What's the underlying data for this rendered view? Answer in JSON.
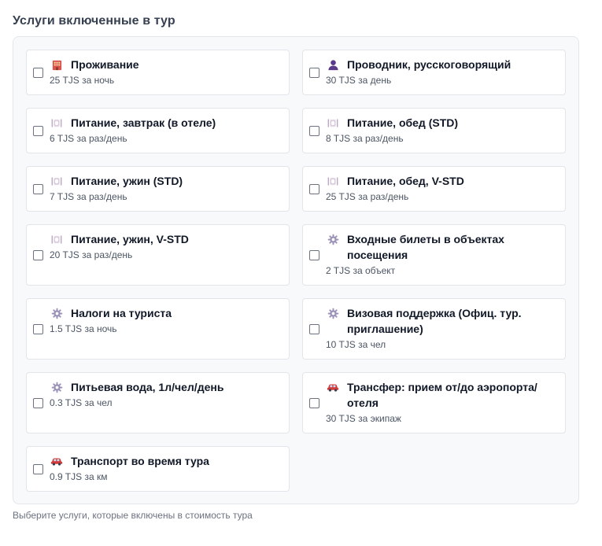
{
  "section": {
    "title": "Услуги включенные в тур",
    "helper": "Выберите услуги, которые включены в стоимость тура"
  },
  "services": [
    {
      "title_lines": [
        "Проживание"
      ],
      "price": "25 TJS за ночь",
      "icon": "hotel-icon",
      "checked": false
    },
    {
      "title_lines": [
        "Проводник, русскоговорящий"
      ],
      "price": "30 TJS за день",
      "icon": "guide-person-icon",
      "checked": false
    },
    {
      "title_lines": [
        "Питание, завтрак (в отеле)"
      ],
      "price": "6 TJS за раз/день",
      "icon": "plate-cutlery-icon",
      "checked": false
    },
    {
      "title_lines": [
        "Питание, обед (STD)"
      ],
      "price": "8 TJS за раз/день",
      "icon": "plate-cutlery-icon",
      "checked": false
    },
    {
      "title_lines": [
        "Питание, ужин (STD)"
      ],
      "price": "7 TJS за раз/день",
      "icon": "plate-cutlery-icon",
      "checked": false
    },
    {
      "title_lines": [
        "Питание, обед, V-STD"
      ],
      "price": "25 TJS за раз/день",
      "icon": "plate-cutlery-icon",
      "checked": false
    },
    {
      "title_lines": [
        "Питание, ужин, V-STD"
      ],
      "price": "20 TJS за раз/день",
      "icon": "plate-cutlery-icon",
      "checked": false
    },
    {
      "title_lines": [
        "Входные билеты в объектах",
        "посещения"
      ],
      "price": "2 TJS за объект",
      "icon": "gear-icon",
      "checked": false
    },
    {
      "title_lines": [
        "Налоги на туриста"
      ],
      "price": "1.5 TJS за ночь",
      "icon": "gear-icon",
      "checked": false
    },
    {
      "title_lines": [
        "Визовая поддержка (Офиц. тур.",
        "приглашение)"
      ],
      "price": "10 TJS за чел",
      "icon": "gear-icon",
      "checked": false
    },
    {
      "title_lines": [
        "Питьевая вода, 1л/чел/день"
      ],
      "price": "0.3 TJS за чел",
      "icon": "gear-icon",
      "checked": false
    },
    {
      "title_lines": [
        "Трансфер: прием от/до аэропорта/",
        "отеля"
      ],
      "price": "30 TJS за экипаж",
      "icon": "car-icon",
      "checked": false
    },
    {
      "title_lines": [
        "Транспорт во время тура"
      ],
      "price": "0.9 TJS за км",
      "icon": "car-icon",
      "checked": false
    }
  ]
}
